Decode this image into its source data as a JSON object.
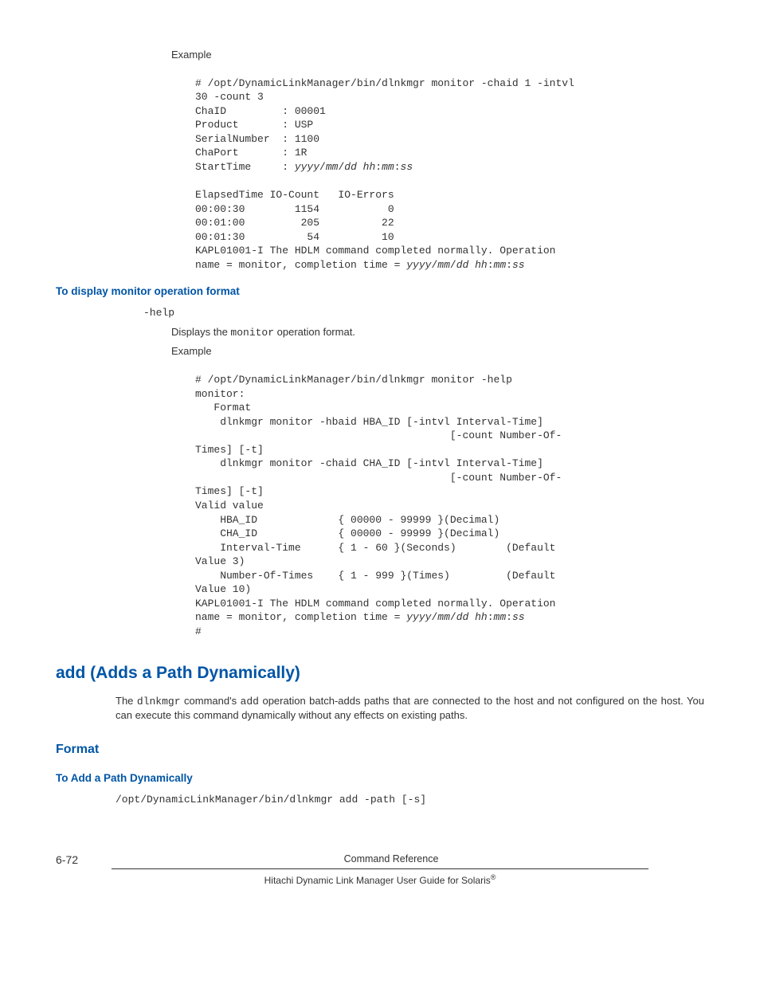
{
  "example1": {
    "label": "Example",
    "line1": "# /opt/DynamicLinkManager/bin/dlnkmgr monitor -chaid 1 -intvl",
    "line2": "30 -count 3",
    "line3": "ChaID         : 00001",
    "line4": "Product       : USP",
    "line5": "SerialNumber  : 1100",
    "line6": "ChaPort       : 1R",
    "line7a": "StartTime     : ",
    "line7b": "yyyy",
    "line7c": "/",
    "line7d": "mm",
    "line7e": "/",
    "line7f": "dd hh",
    "line7g": ":",
    "line7h": "mm",
    "line7i": ":",
    "line7j": "ss",
    "line8": "",
    "line9": "ElapsedTime IO-Count   IO-Errors",
    "line10": "00:00:30        1154           0",
    "line11": "00:01:00         205          22",
    "line12": "00:01:30          54          10",
    "line13": "KAPL01001-I The HDLM command completed normally. Operation",
    "line14a": "name = monitor, completion time = ",
    "line14b": "yyyy",
    "line14c": "/",
    "line14d": "mm",
    "line14e": "/",
    "line14f": "dd hh",
    "line14g": ":",
    "line14h": "mm",
    "line14i": ":",
    "line14j": "ss"
  },
  "section1_heading": "To display monitor operation format",
  "help_term": "-help",
  "help_desc_a": "Displays the ",
  "help_desc_b": "monitor",
  "help_desc_c": " operation format.",
  "example2": {
    "label": "Example",
    "l1": "# /opt/DynamicLinkManager/bin/dlnkmgr monitor -help",
    "l2": "monitor:",
    "l3": "   Format",
    "l4": "    dlnkmgr monitor -hbaid HBA_ID [-intvl Interval-Time]",
    "l5": "                                         [-count Number-Of-",
    "l6": "Times] [-t]",
    "l7": "    dlnkmgr monitor -chaid CHA_ID [-intvl Interval-Time]",
    "l8": "                                         [-count Number-Of-",
    "l9": "Times] [-t]",
    "l10": "Valid value",
    "l11": "    HBA_ID             { 00000 - 99999 }(Decimal)",
    "l12": "    CHA_ID             { 00000 - 99999 }(Decimal)",
    "l13": "    Interval-Time      { 1 - 60 }(Seconds)        (Default",
    "l14": "Value 3)",
    "l15": "    Number-Of-Times    { 1 - 999 }(Times)         (Default",
    "l16": "Value 10)",
    "l17": "KAPL01001-I The HDLM command completed normally. Operation",
    "l18a": "name = monitor, completion time = ",
    "l18b": "yyyy",
    "l18c": "/",
    "l18d": "mm",
    "l18e": "/",
    "l18f": "dd hh",
    "l18g": ":",
    "l18h": "mm",
    "l18i": ":",
    "l18j": "ss",
    "l19": "#"
  },
  "main_heading": "add (Adds a Path Dynamically)",
  "body_para_a": "The ",
  "body_para_b": "dlnkmgr",
  "body_para_c": " command's ",
  "body_para_d": "add",
  "body_para_e": " operation batch-adds paths that are connected to the host and not configured on the host. You can execute this command dynamically without any effects on existing paths.",
  "format_heading": "Format",
  "add_path_heading": "To Add a Path Dynamically",
  "add_cmd": "/opt/DynamicLinkManager/bin/dlnkmgr add -path [-s]",
  "footer": {
    "page": "6-72",
    "title": "Command Reference",
    "subtitle_a": "Hitachi Dynamic Link Manager User Guide for Solaris",
    "subtitle_b": "®"
  }
}
